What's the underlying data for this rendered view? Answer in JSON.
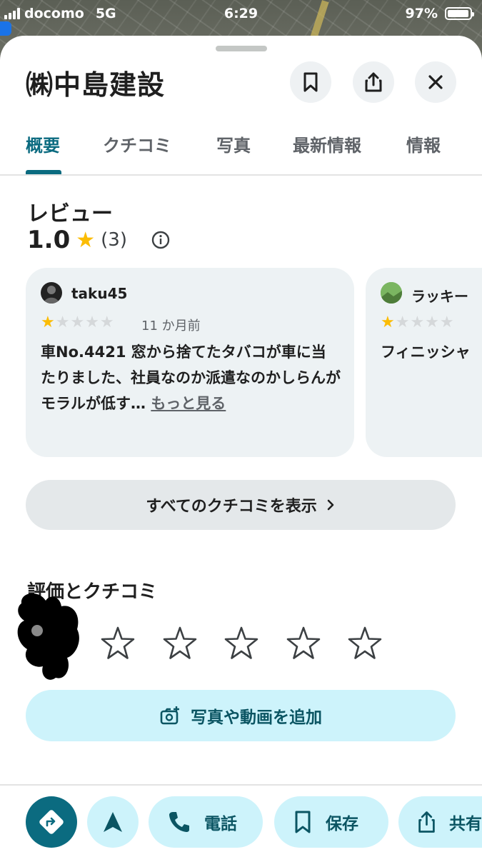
{
  "status_bar": {
    "carrier": "docomo",
    "network": "5G",
    "time": "6:29",
    "battery": "97%"
  },
  "place": {
    "title": "㈱中島建設"
  },
  "tabs": [
    "概要",
    "クチコミ",
    "写真",
    "最新情報",
    "情報"
  ],
  "active_tab": "概要",
  "reviews": {
    "heading": "レビュー",
    "rating": "1.0",
    "count": "(3)",
    "cards": [
      {
        "reviewer": "taku45",
        "stars": 1,
        "date": "11 か月前",
        "text": "車No.4421 窓から捨てたタバコが車に当たりました、社員なのか派遣なのかしらんがモラルが低す…",
        "more": "もっと見る"
      },
      {
        "reviewer": "ラッキー",
        "stars": 1,
        "text": "フィニッシャ"
      }
    ],
    "all_button": "すべてのクチコミを表示"
  },
  "rate": {
    "heading": "評価とクチコミ",
    "add_media": "写真や動画を追加"
  },
  "actions": {
    "call": "電話",
    "save": "保存",
    "share": "共有"
  },
  "colors": {
    "accent": "#0b6b80",
    "pill_bg": "#cdf3fb",
    "star": "#fbbc04"
  }
}
